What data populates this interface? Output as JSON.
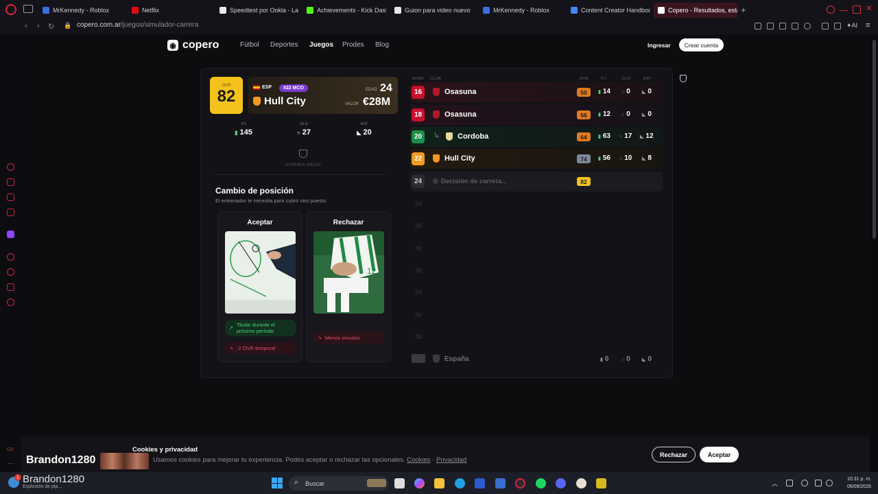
{
  "browser": {
    "tabs": [
      {
        "label": "MrKennedy - Roblox",
        "color": "#3b6fe0"
      },
      {
        "label": "Netflix",
        "color": "#e50914"
      },
      {
        "label": "Speedtest por Ookla - La p",
        "color": "#e8e8e8"
      },
      {
        "label": "Achievements - Kick Dash",
        "color": "#53fc18"
      },
      {
        "label": "Guion para video nuevo",
        "color": "#e8e8e8"
      },
      {
        "label": "MrKennedy - Roblox",
        "color": "#3b6fe0"
      },
      {
        "label": "Content Creator Handbook",
        "color": "#4285f4"
      },
      {
        "label": "Copero - Resultados, estad",
        "color": "#ffffff"
      }
    ],
    "url_host": "copero.com.ar",
    "url_path": "/juegos/simulador-carrera"
  },
  "site": {
    "logo": "copero",
    "nav": [
      "Fútbol",
      "Deportes",
      "Juegos",
      "Prodes",
      "Blog"
    ],
    "login": "Ingresar",
    "signup": "Crear cuenta"
  },
  "player": {
    "ovr_label": "OVR",
    "ovr": "82",
    "nationality": "ESP",
    "rank": "#22 MCO",
    "club": "Hull City",
    "age_label": "EDAD",
    "age": "24",
    "value_label": "VALOR",
    "value": "€28M",
    "stats": [
      {
        "label": "PJ",
        "value": "145"
      },
      {
        "label": "GLS",
        "value": "27"
      },
      {
        "label": "AST",
        "value": "20"
      }
    ],
    "trophy_case": "VITRINA VACÍA"
  },
  "decision": {
    "title": "Cambio de posición",
    "subtitle": "El entrenador te necesita para cubrir otro puesto.",
    "accept": {
      "title": "Aceptar",
      "pros": "Titular durante el próximo período",
      "cons": "-2 OVR temporal"
    },
    "reject": {
      "title": "Rechazar",
      "cons": "Menos minutos"
    }
  },
  "career": {
    "headers": [
      "EDAD",
      "CLUB",
      "OVR",
      "PJ",
      "GLS",
      "AST"
    ],
    "rows": [
      {
        "age": "16",
        "club": "Osasuna",
        "ovr": "50",
        "pj": "14",
        "gls": "0",
        "ast": "0",
        "age_color": "#c8102e",
        "ovr_color": "#e07a1f"
      },
      {
        "age": "18",
        "club": "Osasuna",
        "ovr": "56",
        "pj": "12",
        "gls": "0",
        "ast": "0",
        "age_color": "#c8102e",
        "ovr_color": "#e07a1f"
      },
      {
        "age": "20",
        "club": "Cordoba",
        "ovr": "64",
        "pj": "63",
        "gls": "17",
        "ast": "12",
        "age_color": "#1e8e4a",
        "ovr_color": "#e07a1f"
      },
      {
        "age": "22",
        "club": "Hull City",
        "ovr": "74",
        "pj": "56",
        "gls": "10",
        "ast": "8",
        "age_color": "#f29a1f",
        "ovr_color": "#7d8a9c"
      }
    ],
    "current": {
      "age": "24",
      "label": "Decisión de carrera...",
      "ovr": "82"
    },
    "future_ages": [
      "26",
      "28",
      "30",
      "32",
      "34",
      "36",
      "38"
    ],
    "national": {
      "name": "España",
      "pj": "0",
      "gls": "0",
      "ast": "0"
    }
  },
  "cookies": {
    "title": "Cookies y privacidad",
    "text": "Usamos cookies para mejorar tu experiencia. Podés aceptar o rechazar las opcionales.",
    "link_cookies": "Cookies",
    "separator": "·",
    "link_privacy": "Privacidad",
    "reject": "Rechazar",
    "accept": "Aceptar"
  },
  "stream": {
    "name": "Brandon1280"
  },
  "taskbar": {
    "user": "Brandon1280",
    "user_sub": "Explosión de pip...",
    "badge": "1",
    "search": "Buscar",
    "time": "10:31 p. m.",
    "date": "06/08/2026"
  }
}
